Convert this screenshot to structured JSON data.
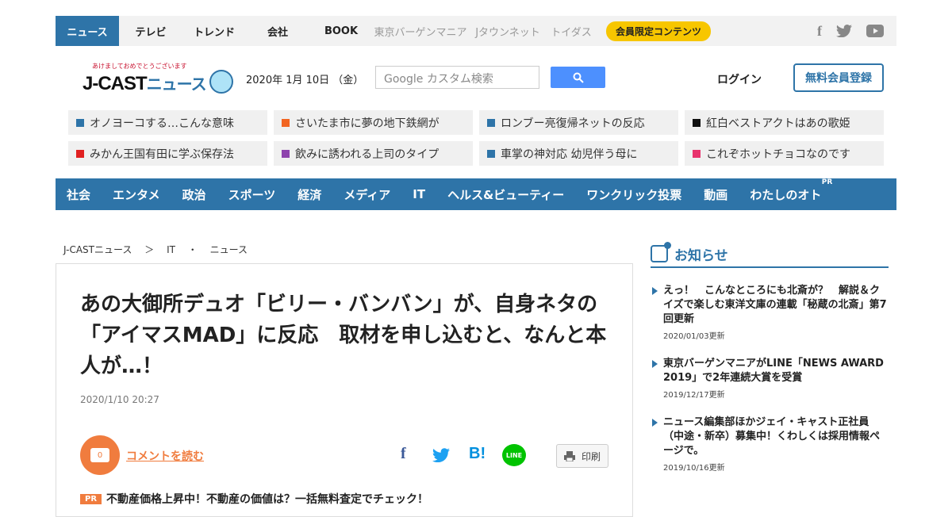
{
  "topnav": {
    "items": [
      "ニュース",
      "テレビ",
      "トレンド",
      "会社",
      "BOOK"
    ],
    "gray_items": [
      "東京バーゲンマニア",
      "Jタウンネット",
      "トイダス"
    ],
    "member": "会員限定コンテンツ",
    "socials": [
      "f",
      "twitter",
      "youtube"
    ]
  },
  "header": {
    "logo_small": "あけましておめでとうございます",
    "logo_jcast": "J-CAST",
    "logo_news": "ニュース",
    "date": "2020年 1月 10日 （金）",
    "search_placeholder": "Google カスタム検索",
    "login": "ログイン",
    "signup": "無料会員登録"
  },
  "pickups": [
    {
      "text": "オノヨーコする…こんな意味",
      "color": "#2e74a8"
    },
    {
      "text": "さいたま市に夢の地下鉄網が",
      "color": "#f26522"
    },
    {
      "text": "ロンブー亮復帰ネットの反応",
      "color": "#2e74a8"
    },
    {
      "text": "紅白ベストアクトはあの歌姫",
      "color": "#111111"
    },
    {
      "text": "みかん王国有田に学ぶ保存法",
      "color": "#e02020"
    },
    {
      "text": "飲みに誘われる上司のタイプ",
      "color": "#8e44ad"
    },
    {
      "text": "車掌の神対応 幼児伴う母に",
      "color": "#2e74a8"
    },
    {
      "text": "これぞホットチョコなのです",
      "color": "#e8336d"
    }
  ],
  "categories": [
    "社会",
    "エンタメ",
    "政治",
    "スポーツ",
    "経済",
    "メディア",
    "IT",
    "ヘルス&ビューティー",
    "ワンクリック投票",
    "動画",
    "わたしのオト"
  ],
  "cat_pr": "PR",
  "breadcrumb": [
    "J-CASTニュース",
    "＞",
    "IT",
    "・",
    "ニュース"
  ],
  "article": {
    "title": "あの大御所デュオ「ビリー・バンバン」が、自身ネタの「アイマスMAD」に反応　取材を申し込むと、なんと本人が…！",
    "date": "2020/1/10 20:27",
    "comment_count": "0",
    "comment_link": "コメントを読む",
    "share": [
      "f",
      "t",
      "B!",
      "LINE"
    ],
    "print": "印刷",
    "pr_badge": "PR",
    "pr_text": "不動産価格上昇中！不動産の価値は？一括無料査定でチェック！"
  },
  "sidebar": {
    "heading": "お知らせ",
    "notices": [
      {
        "title": "えっ！　こんなところにも北斎が？　解説＆クイズで楽しむ東洋文庫の連載「秘蔵の北斎」第7回更新",
        "date": "2020/01/03更新"
      },
      {
        "title": "東京バーゲンマニアがLINE「NEWS AWARD 2019」で2年連続大賞を受賞",
        "date": "2019/12/17更新"
      },
      {
        "title": "ニュース編集部ほかジェイ・キャスト正社員（中途・新卒）募集中！くわしくは採用情報ページで。",
        "date": "2019/10/16更新"
      }
    ]
  }
}
